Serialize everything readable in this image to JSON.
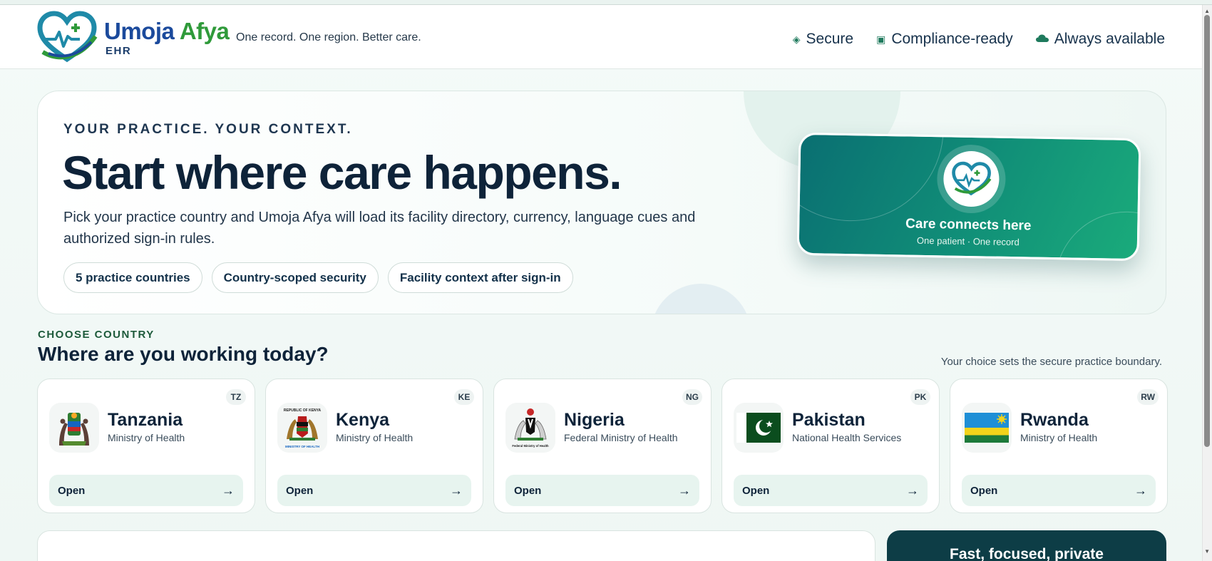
{
  "header": {
    "brand_name_part1": "Umoja",
    "brand_name_part2": "Afya",
    "brand_sub": "EHR",
    "tagline": "One record. One region. Better care.",
    "badges": [
      {
        "icon": "diamond-icon",
        "label": "Secure"
      },
      {
        "icon": "square-icon",
        "label": "Compliance-ready"
      },
      {
        "icon": "cloud-icon",
        "label": "Always available"
      }
    ]
  },
  "hero": {
    "eyebrow": "YOUR PRACTICE. YOUR CONTEXT.",
    "title": "Start where care happens.",
    "description": "Pick your practice country and Umoja Afya will load its facility directory, currency, language cues and authorized sign-in rules.",
    "pills": [
      "5 practice countries",
      "Country-scoped security",
      "Facility context after sign-in"
    ],
    "card": {
      "title": "Care connects here",
      "subtitle": "One patient · One record"
    }
  },
  "countries": {
    "eyebrow": "CHOOSE COUNTRY",
    "title": "Where are you working today?",
    "note": "Your choice sets the secure practice boundary.",
    "open_label": "Open",
    "arrow": "→",
    "items": [
      {
        "code": "TZ",
        "name": "Tanzania",
        "ministry": "Ministry of Health",
        "emblem": "tanzania-coat-of-arms"
      },
      {
        "code": "KE",
        "name": "Kenya",
        "ministry": "Ministry of Health",
        "emblem": "kenya-coat-of-arms",
        "emblem_top_text": "REPUBLIC OF KENYA",
        "emblem_bottom_text": "MINISTRY OF HEALTH"
      },
      {
        "code": "NG",
        "name": "Nigeria",
        "ministry": "Federal Ministry of Health",
        "emblem": "nigeria-coat-of-arms",
        "emblem_bottom_text": "Federal Ministry of Health"
      },
      {
        "code": "PK",
        "name": "Pakistan",
        "ministry": "National Health Services",
        "emblem": "pakistan-flag"
      },
      {
        "code": "RW",
        "name": "Rwanda",
        "ministry": "Ministry of Health",
        "emblem": "rwanda-flag"
      }
    ]
  },
  "bottom": {
    "right_title": "Fast, focused, private"
  },
  "colors": {
    "brand_blue": "#1b4a9c",
    "brand_green": "#2f9a3a",
    "accent_teal": "#119078",
    "dark_navy": "#0e2339"
  }
}
